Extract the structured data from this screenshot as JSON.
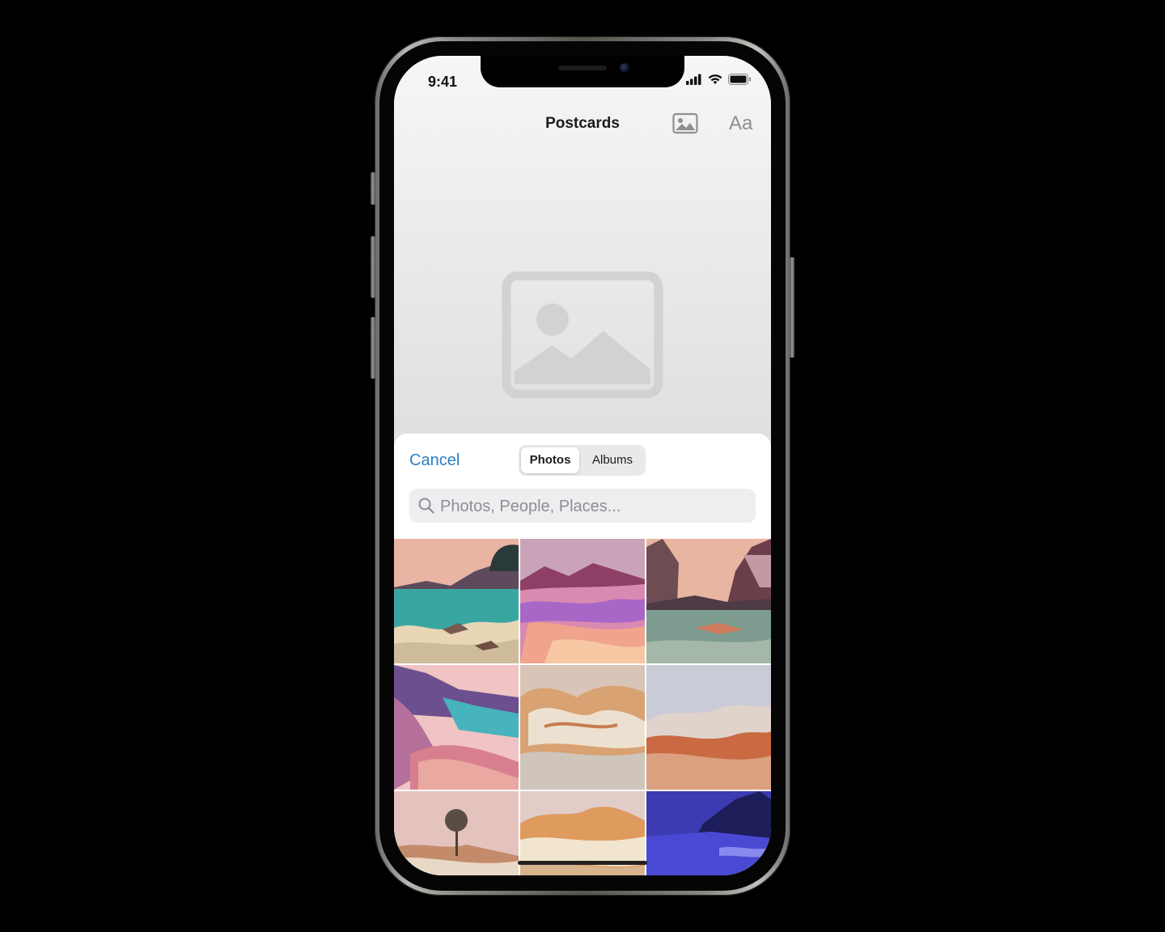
{
  "status_bar": {
    "time": "9:41"
  },
  "nav": {
    "title": "Postcards",
    "font_button_label": "Aa"
  },
  "picker": {
    "cancel_label": "Cancel",
    "segments": [
      "Photos",
      "Albums"
    ],
    "selected_segment": "Photos",
    "search_placeholder": "Photos, People, Places...",
    "search_value": ""
  },
  "colors": {
    "accent": "#2b7fc4"
  }
}
